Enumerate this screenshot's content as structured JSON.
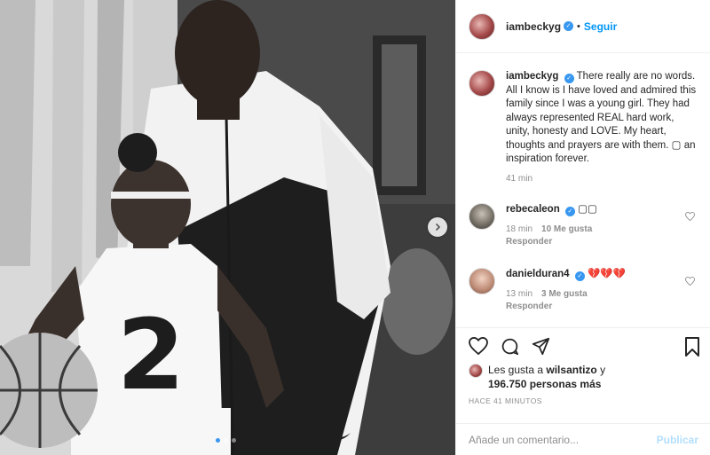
{
  "header": {
    "username": "iambeckyg",
    "separator": "•",
    "follow_label": "Seguir",
    "verified_glyph": "✓"
  },
  "caption": {
    "username": "iambeckyg",
    "text": "There really are no words. All I know is I have loved and admired this family since I was a young girl. They had always represented REAL hard work, unity, honesty and LOVE. My heart, thoughts and prayers are with them. ▢ an inspiration forever.",
    "time": "41 min"
  },
  "comments": [
    {
      "username": "rebecaleon",
      "text": "▢▢",
      "time": "18 min",
      "likes": "10 Me gusta",
      "reply": "Responder"
    },
    {
      "username": "danielduran4",
      "text": "💔💔💔",
      "time": "13 min",
      "likes": "3 Me gusta",
      "reply": "Responder"
    }
  ],
  "likes": {
    "prefix": "Les gusta a",
    "user": "wilsantizo",
    "connector": "y",
    "others": "196.750 personas más"
  },
  "timestamp": "HACE 41 MINUTOS",
  "add_comment": {
    "placeholder": "Añade un comentario...",
    "publish_label": "Publicar"
  },
  "photo": {
    "jersey_number": "2"
  },
  "carousel": {
    "current_index": 1,
    "total": 3
  },
  "colors": {
    "accent": "#0095f6",
    "publish_disabled": "#b2dffc",
    "meta_gray": "#8e8e8e",
    "broken_heart": "#ed4956"
  },
  "icons": [
    "heart-icon",
    "comment-icon",
    "share-icon",
    "bookmark-icon",
    "chevron-right-icon",
    "verified-icon"
  ]
}
